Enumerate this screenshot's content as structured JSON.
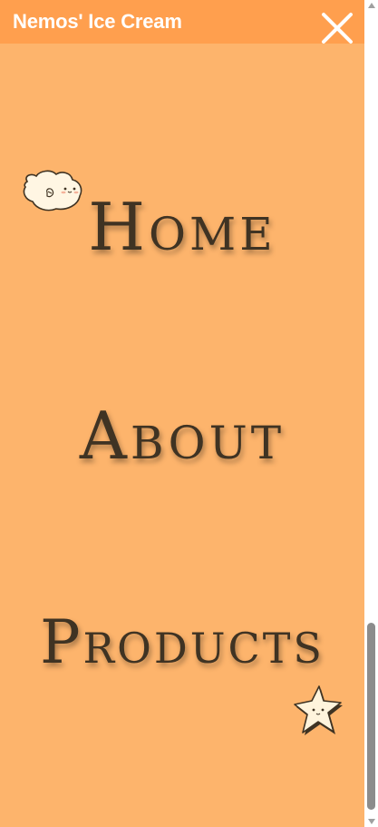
{
  "header": {
    "brand": "Nemos' Ice Cream",
    "close_icon": "close-x-icon"
  },
  "menu": {
    "items": [
      {
        "label": "Home"
      },
      {
        "label": "About"
      },
      {
        "label": "Products"
      }
    ]
  },
  "decorations": {
    "fish_icon": "pufferfish-icon",
    "star_icon": "starfish-icon"
  },
  "colors": {
    "page_background": "#fdb46c",
    "header_background": "#ff9f4e",
    "menu_text": "#3f3323",
    "brand_text": "#ffffff"
  },
  "scrollbar": {
    "scroll_position": 1.0
  }
}
